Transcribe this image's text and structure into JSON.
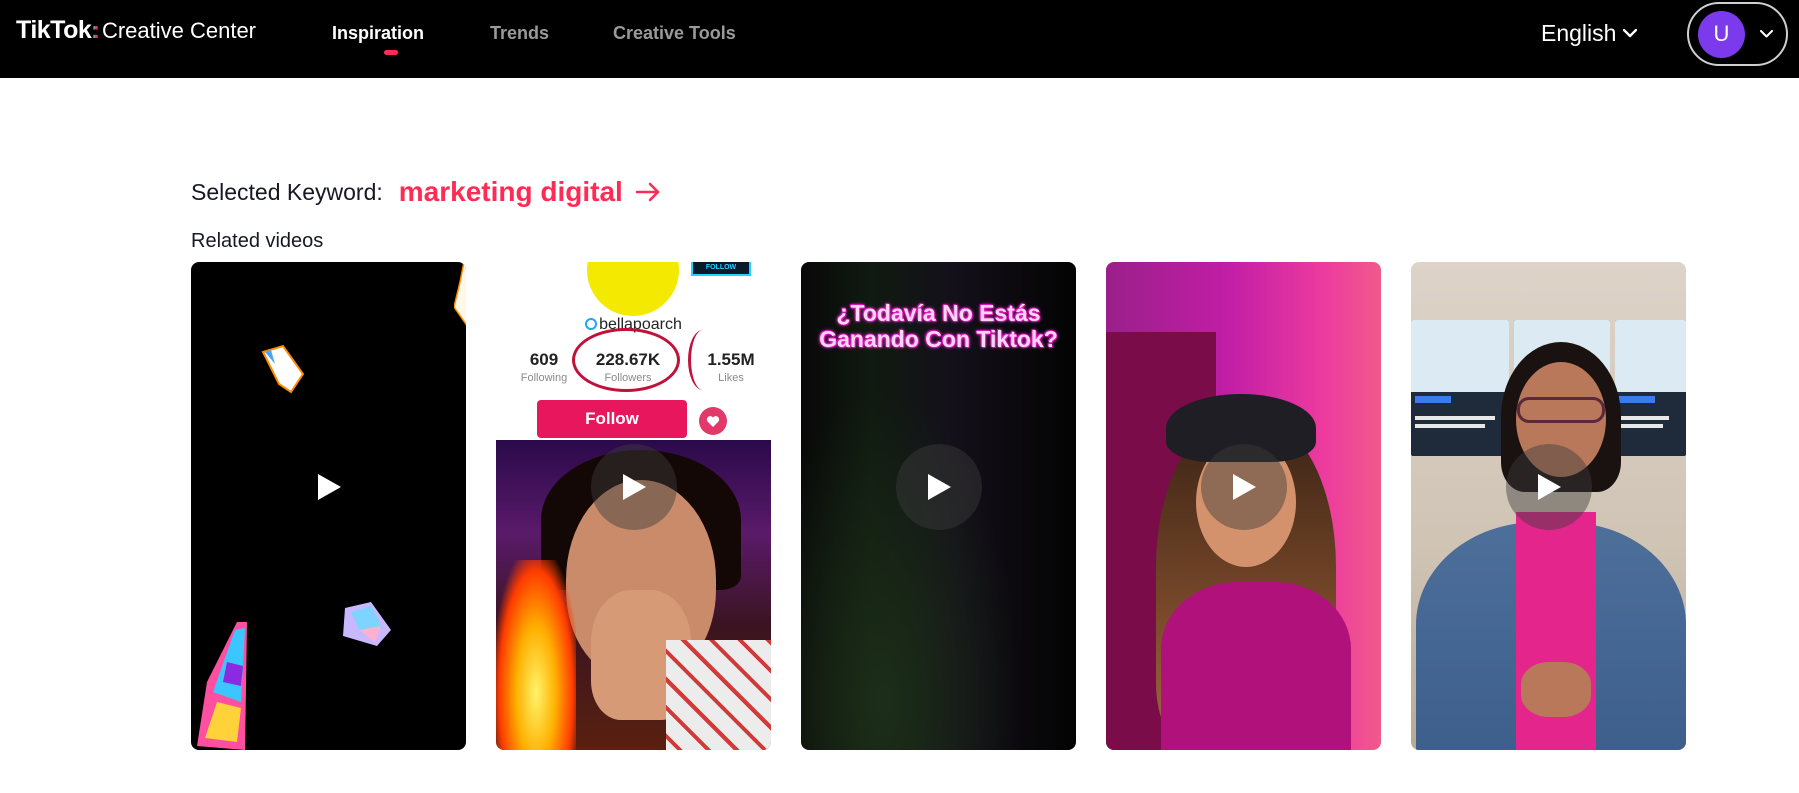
{
  "header": {
    "logo": {
      "brand": "TikTok",
      "separator": ":",
      "product": "Creative Center"
    },
    "tabs": [
      {
        "label": "Inspiration",
        "active": true
      },
      {
        "label": "Trends",
        "active": false
      },
      {
        "label": "Creative Tools",
        "active": false
      }
    ],
    "language": "English",
    "user_initial": "U"
  },
  "keyword": {
    "label": "Selected Keyword:",
    "value": "marketing digital"
  },
  "related_label": "Related videos",
  "videos": [
    {
      "id": 1
    },
    {
      "id": 2,
      "overlay": {
        "follow_tag": "FOLLOW",
        "handle": "bellapoarch",
        "following_value": "609",
        "following_label": "Following",
        "followers_value": "228.67K",
        "followers_label": "Followers",
        "likes_value": "1.55M",
        "likes_label": "Likes",
        "follow_button": "Follow"
      }
    },
    {
      "id": 3,
      "caption": "¿Todavía No Estás Ganando Con Tiktok?"
    },
    {
      "id": 4
    },
    {
      "id": 5
    }
  ],
  "colors": {
    "brand_accent": "#fe2c55",
    "header_bg": "#000000",
    "avatar_bg": "#7c3aed"
  },
  "icons": {
    "language_dropdown": "chevron-down-icon",
    "user_dropdown": "chevron-down-icon",
    "keyword_link": "arrow-right-icon",
    "video_play": "play-icon"
  }
}
